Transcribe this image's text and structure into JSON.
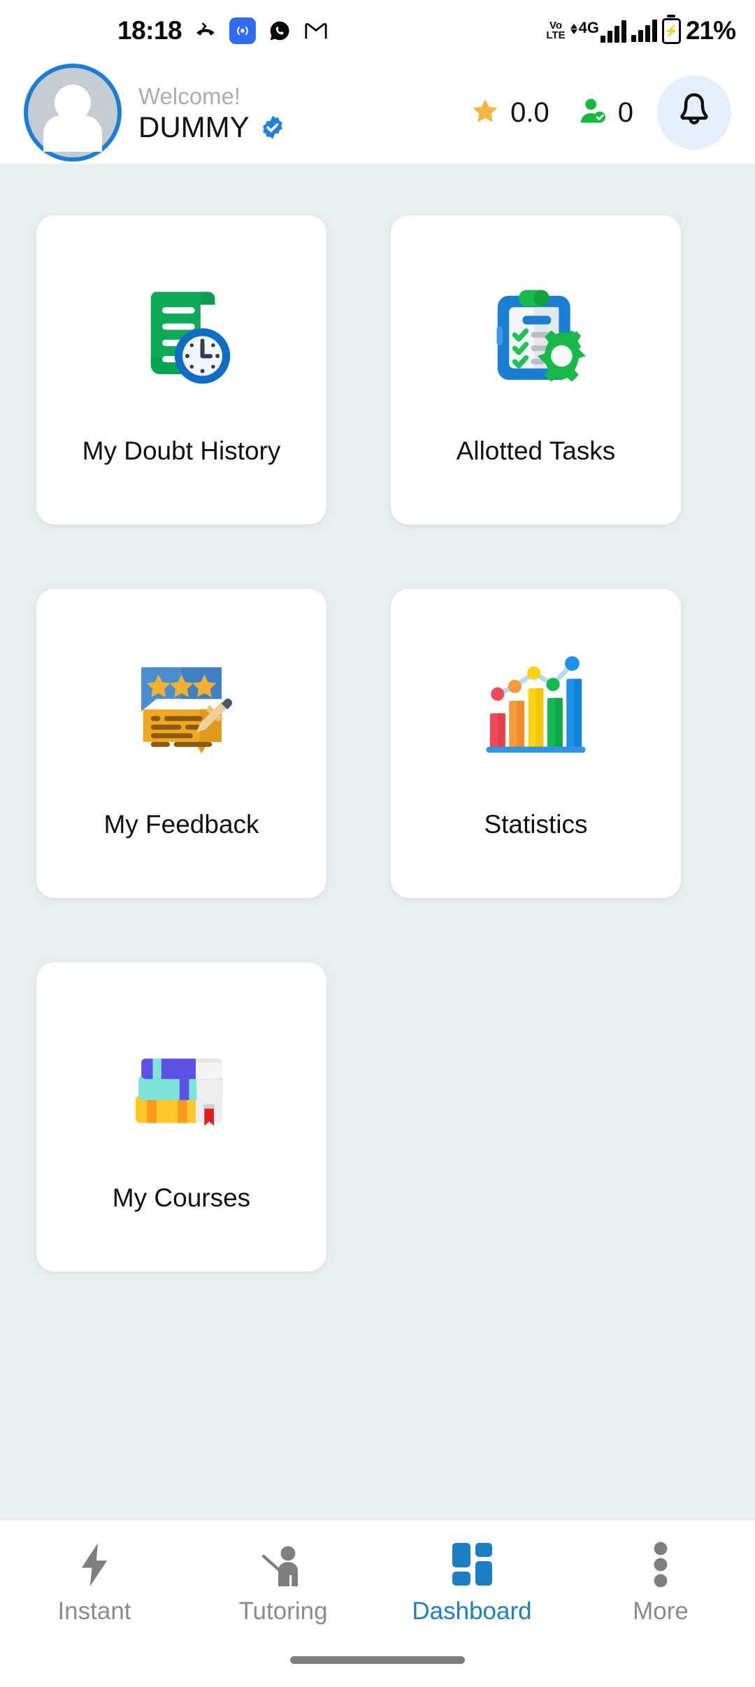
{
  "status_bar": {
    "time": "18:18",
    "icons": [
      "missed-call-icon",
      "broadcast-icon",
      "whatsapp-icon",
      "gmail-icon"
    ],
    "volte_line1": "Vo",
    "volte_line2": "LTE",
    "network_type": "4G",
    "battery_percent": "21%"
  },
  "header": {
    "welcome_label": "Welcome!",
    "user_name": "DUMMY",
    "verified": true,
    "rating_value": "0.0",
    "students_value": "0",
    "accent_color": "#1a7fd4",
    "bell_bg_color": "#e3f0fb"
  },
  "dashboard": {
    "background_color": "#e8eff1",
    "cards": [
      {
        "label": "My Doubt History",
        "icon": "document-clock-icon"
      },
      {
        "label": "Allotted Tasks",
        "icon": "clipboard-checklist-gear-icon"
      },
      {
        "label": "My Feedback",
        "icon": "review-chat-stars-icon"
      },
      {
        "label": "Statistics",
        "icon": "bar-chart-trend-icon"
      },
      {
        "label": "My Courses",
        "icon": "book-stack-icon"
      }
    ]
  },
  "bottom_nav": {
    "active_color": "#1b7fc4",
    "inactive_color": "#8b8b8b",
    "items": [
      {
        "label": "Instant",
        "icon": "lightning-bolt-icon",
        "active": false
      },
      {
        "label": "Tutoring",
        "icon": "teacher-pointer-icon",
        "active": false
      },
      {
        "label": "Dashboard",
        "icon": "grid-blocks-icon",
        "active": true
      },
      {
        "label": "More",
        "icon": "three-dots-vertical-icon",
        "active": false
      }
    ]
  }
}
